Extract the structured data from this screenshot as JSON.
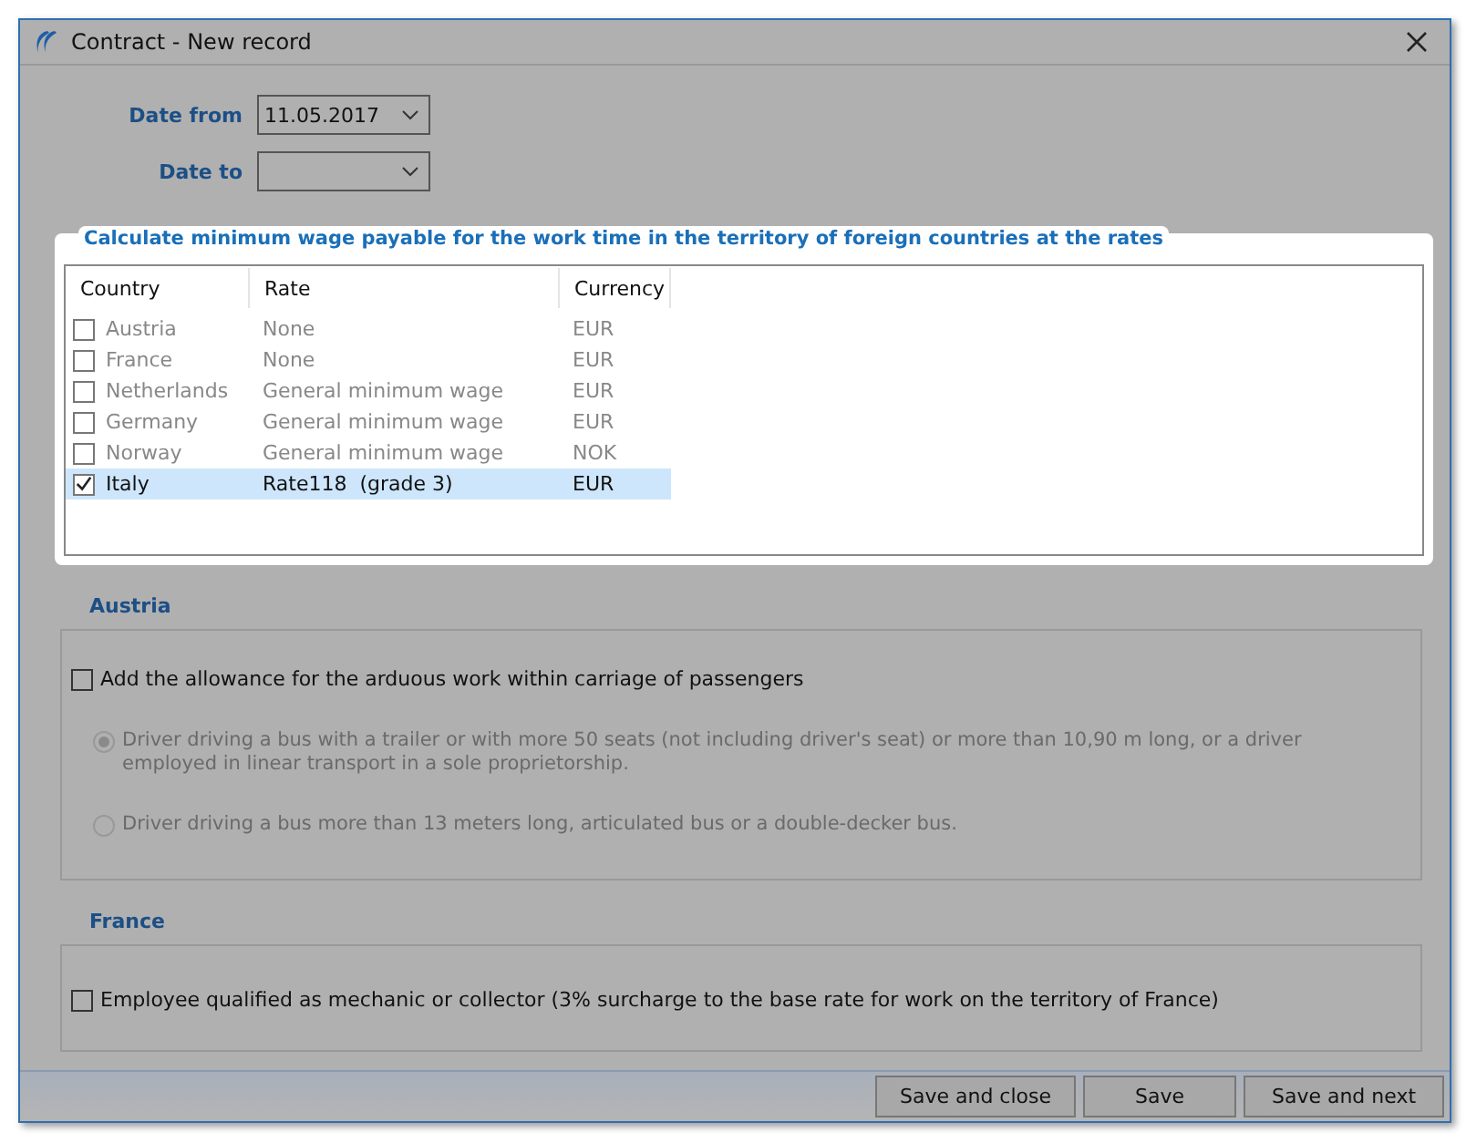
{
  "window": {
    "title": "Contract - New record"
  },
  "date_from": {
    "label": "Date from",
    "value": "11.05.2017"
  },
  "date_to": {
    "label": "Date to"
  },
  "rates_group": {
    "title": "Calculate minimum wage payable for the work time in the territory of foreign countries at the rates",
    "columns": [
      "Country",
      "Rate",
      "Currency"
    ],
    "rows": [
      {
        "country": "Austria",
        "rate": "None",
        "currency": "EUR",
        "checked": false,
        "selected": false
      },
      {
        "country": "France",
        "rate": "None",
        "currency": "EUR",
        "checked": false,
        "selected": false
      },
      {
        "country": "Netherlands",
        "rate": "General minimum wage",
        "currency": "EUR",
        "checked": false,
        "selected": false
      },
      {
        "country": "Germany",
        "rate": "General minimum wage",
        "currency": "EUR",
        "checked": false,
        "selected": false
      },
      {
        "country": "Norway",
        "rate": "General minimum wage",
        "currency": "NOK",
        "checked": false,
        "selected": false
      },
      {
        "country": "Italy",
        "rate": "Rate118  (grade 3)",
        "currency": "EUR",
        "checked": true,
        "selected": true
      }
    ]
  },
  "austria": {
    "title": "Austria",
    "checkbox": {
      "label": "Add the allowance for the arduous work within carriage of passengers",
      "checked": false
    },
    "options": [
      {
        "label": "Driver driving a bus with a trailer or with more 50 seats (not including driver's seat) or more than 10,90 m long, or a driver employed in linear transport in a sole proprietorship.",
        "selected": true,
        "disabled": true
      },
      {
        "label": "Driver driving a bus more than 13 meters long, articulated bus or a double-decker bus.",
        "selected": false,
        "disabled": true
      }
    ]
  },
  "france": {
    "title": "France",
    "checkbox": {
      "label": "Employee qualified as mechanic or collector (3% surcharge to the base rate for work on the territory of France)",
      "checked": false
    }
  },
  "buttons": [
    "Save and close",
    "Save",
    "Save and next"
  ]
}
